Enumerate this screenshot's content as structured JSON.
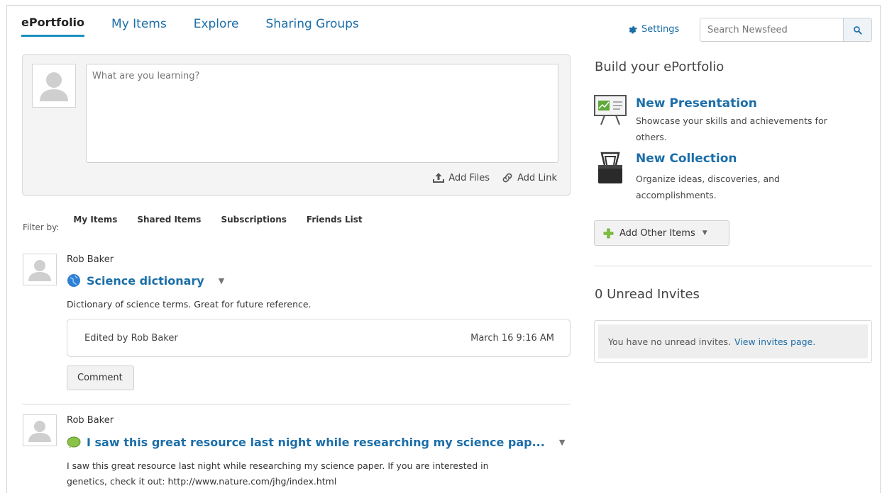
{
  "nav": {
    "tabs": [
      "ePortfolio",
      "My Items",
      "Explore",
      "Sharing Groups"
    ],
    "settings_label": "Settings",
    "search_placeholder": "Search Newsfeed"
  },
  "composer": {
    "placeholder": "What are you learning?",
    "add_files": "Add Files",
    "add_link": "Add Link"
  },
  "filter": {
    "label": "Filter by:",
    "items": [
      "My Items",
      "Shared Items",
      "Subscriptions",
      "Friends List"
    ]
  },
  "feed": [
    {
      "author": "Rob Baker",
      "title": "Science dictionary",
      "description": "Dictionary of science terms. Great for future reference.",
      "edited_by": "Edited by Rob Baker",
      "edited_time": "March 16 9:16 AM",
      "comment_label": "Comment"
    },
    {
      "author": "Rob Baker",
      "title": "I saw this great resource last night while researching my science pap...",
      "description_line1": "I saw this great resource last night while researching my science paper. If you are interested in",
      "description_line2": "genetics, check it out: http://www.nature.com/jhg/index.html"
    }
  ],
  "sidebar": {
    "build_heading": "Build your ePortfolio",
    "new_presentation_title": "New Presentation",
    "new_presentation_desc": "Showcase your skills and achievements for others.",
    "new_collection_title": "New Collection",
    "new_collection_desc": "Organize ideas, discoveries, and accomplishments.",
    "add_other_items": "Add Other Items",
    "unread_heading": "0 Unread Invites",
    "invites_text": "You have no unread invites.",
    "invites_link": "View invites page."
  },
  "colors": {
    "link": "#1b6ea8",
    "active_underline": "#1b8fbf",
    "panel_bg": "#f4f4f4"
  }
}
